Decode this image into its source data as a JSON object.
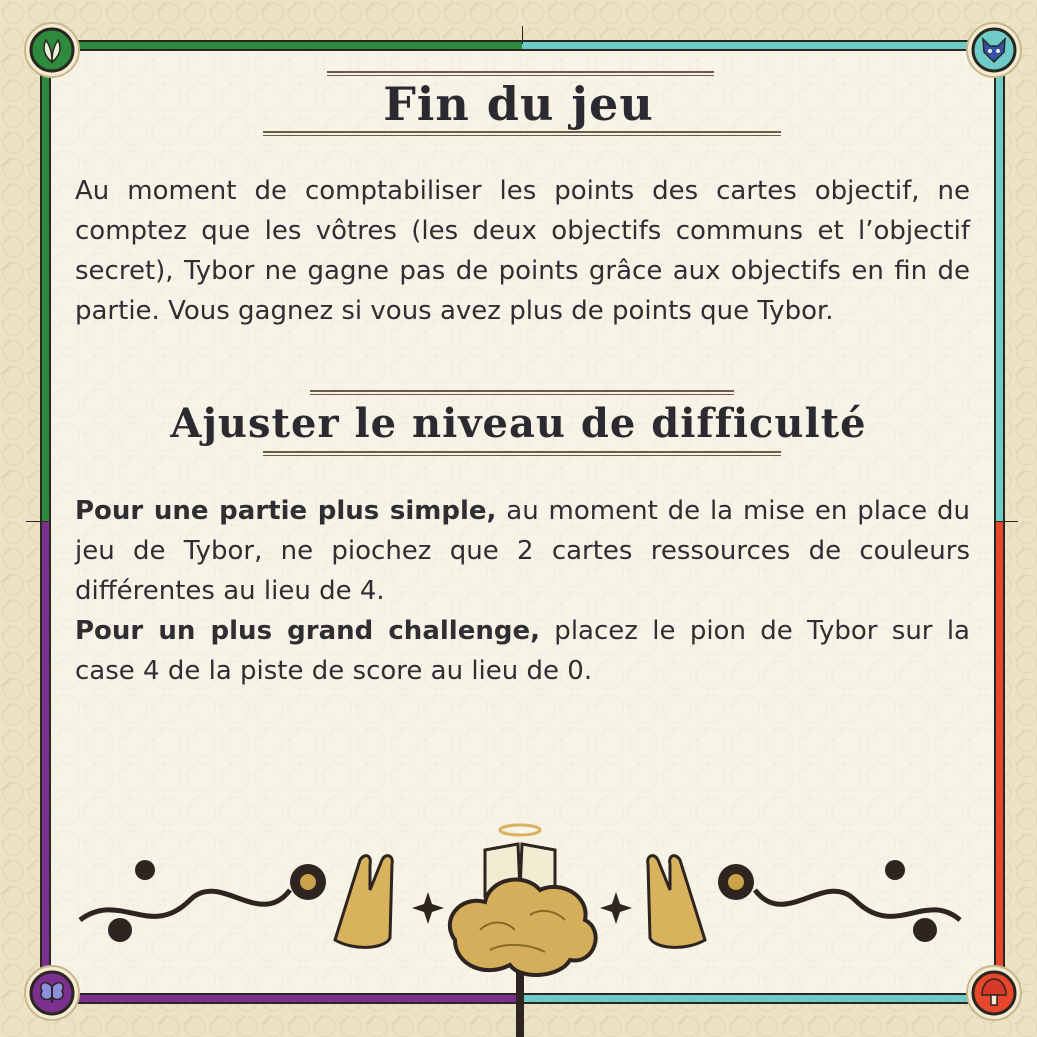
{
  "section1": {
    "title": "Fin du jeu",
    "body": "Au moment de comptabiliser les points des cartes objectif, ne comptez que les vôtres (les deux objectifs communs et l’objectif secret), Tybor ne gagne pas de points grâce aux objectifs en fin de partie. Vous gagnez si vous avez plus de points que Tybor."
  },
  "section2": {
    "title": "Ajuster le niveau de difficulté",
    "simple_bold": "Pour une partie plus simple,",
    "simple_rest": " au moment de la mise en place du jeu de Tybor, ne piochez que 2 cartes ressources de couleurs différentes au lieu de 4.",
    "challenge_bold": "Pour un plus grand challenge,",
    "challenge_rest": " placez le pion de Tybor sur la case 4 de la piste de score au lieu de 0."
  },
  "icons": {
    "top_left": "leaf-icon",
    "top_right": "fox-mask-icon",
    "bottom_left": "butterfly-icon",
    "bottom_right": "mushroom-icon",
    "ornament": "tree-book-ornament"
  },
  "colors": {
    "green": "#2e8b3e",
    "teal": "#6fcbc8",
    "purple": "#7b2f8e",
    "red": "#e8472b",
    "gold": "#c9a24a",
    "ink": "#2f2e33"
  }
}
